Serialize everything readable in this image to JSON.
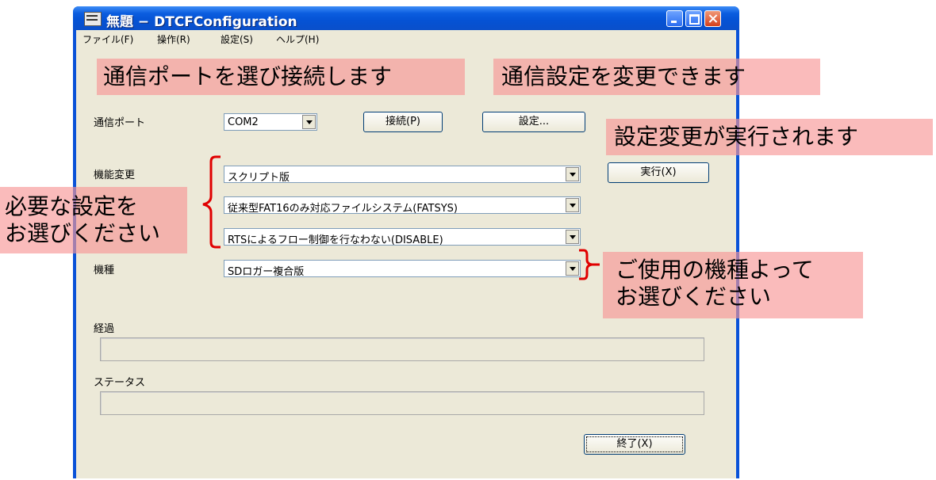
{
  "window": {
    "title": "無題 − DTCFConfiguration"
  },
  "menu": {
    "items": [
      "ファイル(F)",
      "操作(R)",
      "設定(S)",
      "ヘルプ(H)"
    ]
  },
  "port": {
    "label": "通信ポート",
    "value": "COM2",
    "connect_button": "接続(P)",
    "settings_button": "設定..."
  },
  "function": {
    "label": "機能変更",
    "select1": "スクリプト版",
    "select2": "従来型FAT16のみ対応ファイルシステム(FATSYS)",
    "select3": "RTSによるフロー制御を行なわない(DISABLE)",
    "execute_button": "実行(X)"
  },
  "model": {
    "label": "機種",
    "value": "SDロガー複合版"
  },
  "progress": {
    "label": "経過"
  },
  "status": {
    "label": "ステータス"
  },
  "footer": {
    "exit_button": "終了(X)"
  },
  "annotations": {
    "port_note": "通信ポートを選び接続します",
    "settings_note": "通信設定を変更できます",
    "execute_note": "設定変更が実行されます",
    "function_note_line1": "必要な設定を",
    "function_note_line2": "お選びください",
    "model_note_line1": "ご使用の機種よって",
    "model_note_line2": "お選びください"
  },
  "colors": {
    "annotation_bg": "#f79696",
    "bracket": "#e00000",
    "titlebar": "#0a52d8"
  }
}
